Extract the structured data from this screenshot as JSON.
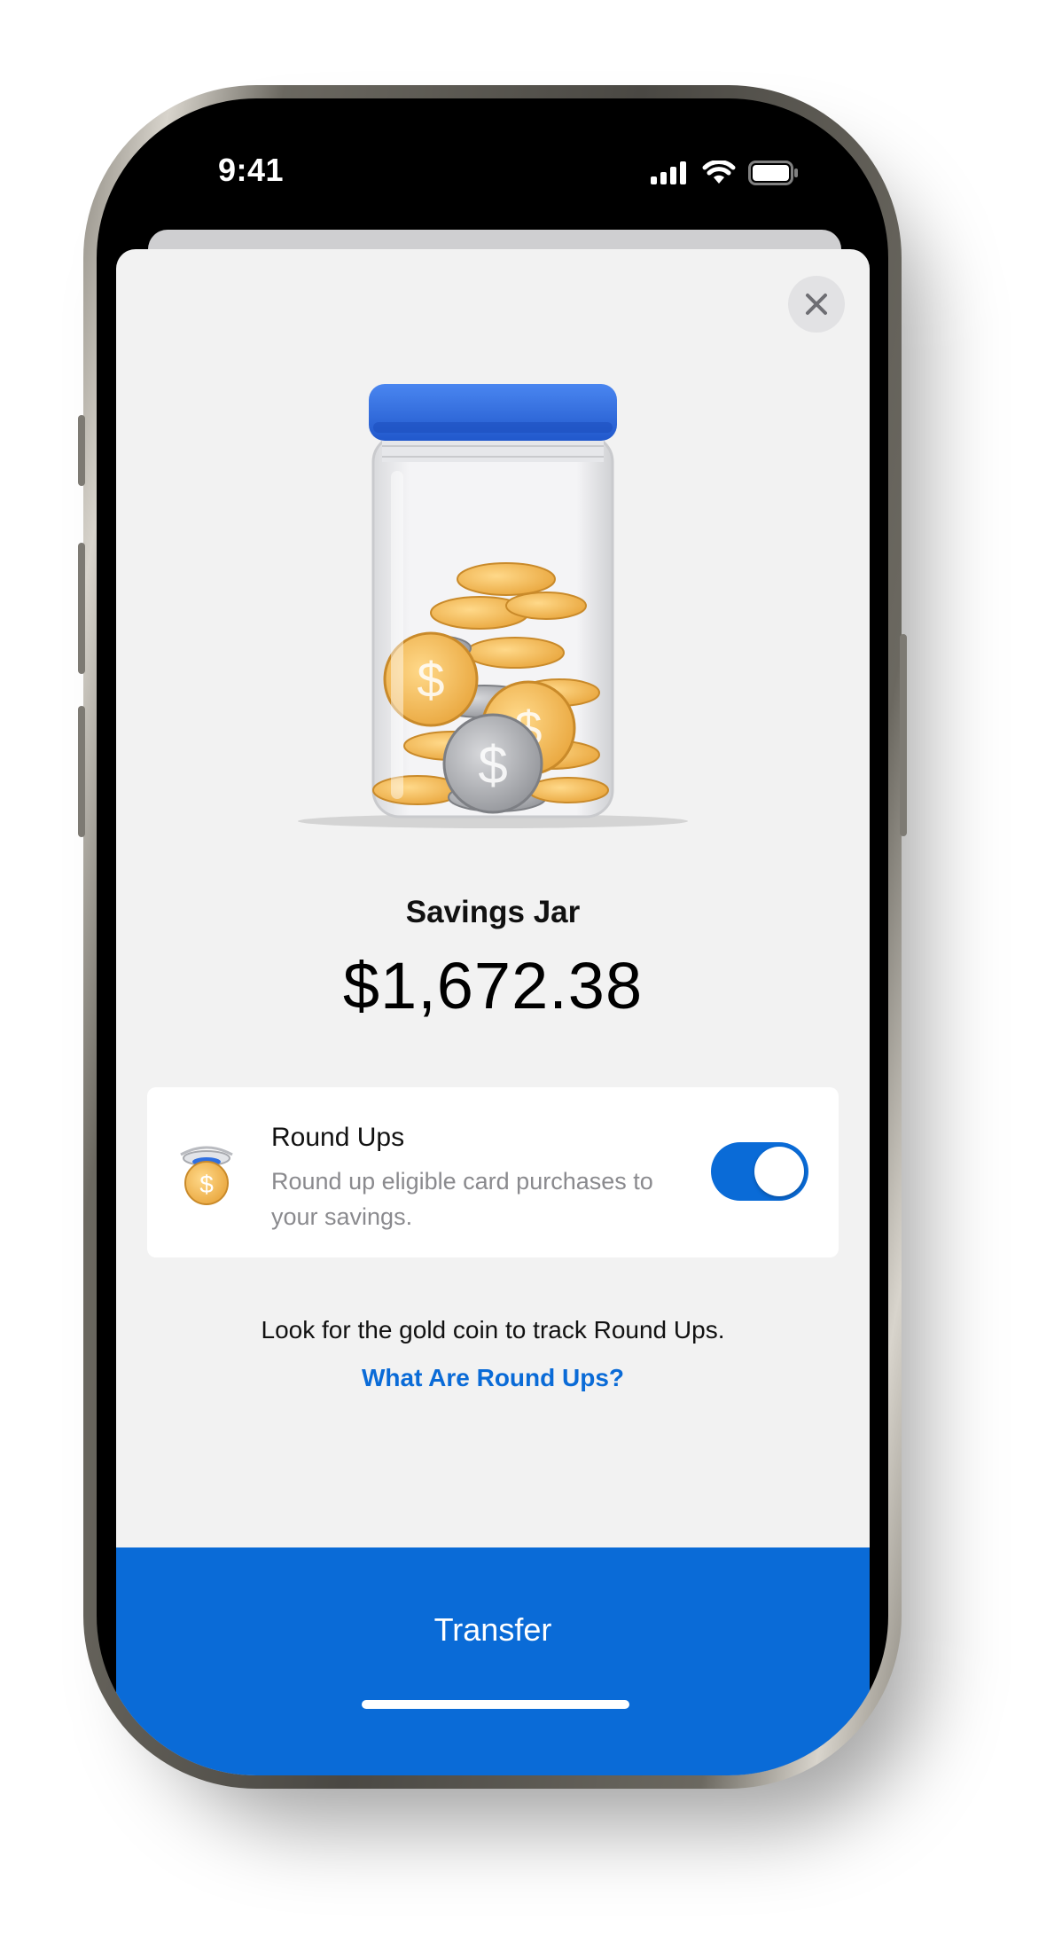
{
  "status_bar": {
    "time": "9:41"
  },
  "sheet": {
    "close_label": "",
    "jar_title": "Savings Jar",
    "balance": "$1,672.38",
    "round_ups": {
      "title": "Round Ups",
      "description": "Round up eligible card purchases to your savings.",
      "toggle_on": true
    },
    "hint": "Look for the gold coin to track Round Ups.",
    "link": "What Are Round Ups?",
    "transfer_label": "Transfer"
  },
  "colors": {
    "accent": "#0a6bd7",
    "sheet_background": "#f2f2f2",
    "jar_lid": "#2f6fe0",
    "coin_gold": "#f2b44a",
    "coin_silver": "#a7a9ad"
  },
  "icons": [
    "close-icon",
    "cellular-signal-icon",
    "wifi-icon",
    "battery-icon",
    "savings-jar-illustration",
    "gold-coin-icon"
  ]
}
